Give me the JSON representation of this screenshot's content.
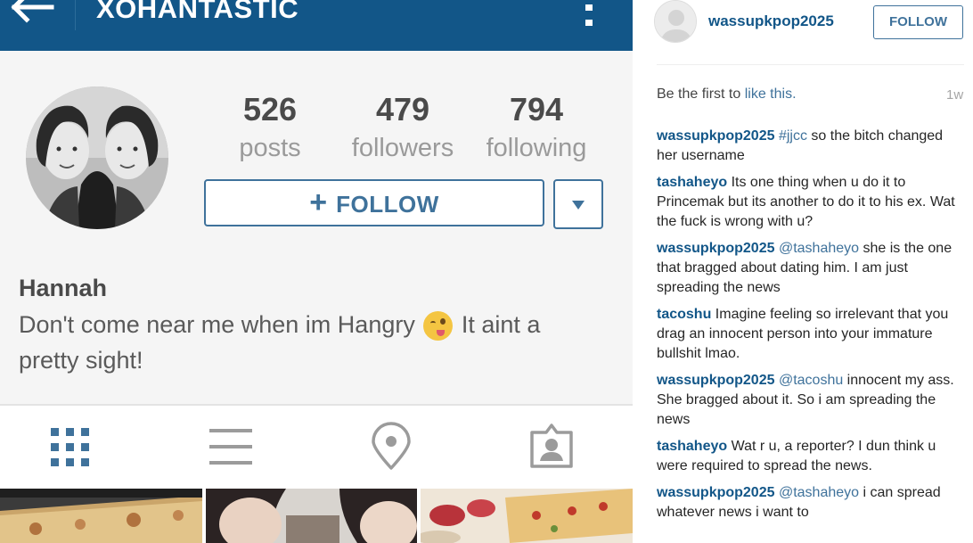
{
  "app_header": {
    "title": "XOHANTASTIC",
    "back_icon": "arrow-left-icon",
    "more_icon": "more-vertical-icon"
  },
  "profile": {
    "avatar": "avatar",
    "stats": [
      {
        "value": "526",
        "label": "posts"
      },
      {
        "value": "479",
        "label": "followers"
      },
      {
        "value": "794",
        "label": "following"
      }
    ],
    "follow_label": "FOLLOW",
    "follow_icon": "plus-icon",
    "dropdown_icon": "caret-down-icon",
    "name": "Hannah",
    "bio_before_emoji": "Don't come near me when im Hangry ",
    "bio_after_emoji": " It aint a pretty sight!",
    "emoji": "winking-face-with-tongue-emoji"
  },
  "tabs": [
    {
      "icon": "grid-icon",
      "active": true
    },
    {
      "icon": "list-icon",
      "active": false
    },
    {
      "icon": "location-pin-icon",
      "active": false
    },
    {
      "icon": "tagged-person-icon",
      "active": false
    }
  ],
  "colors": {
    "header": "#125688",
    "accent": "#3f729b",
    "active_tab": "#3f729b",
    "inactive_tab": "#9b9b9b"
  },
  "post_panel": {
    "username": "wassupkpop2025",
    "follow_label": "FOLLOW",
    "likes_prefix": "Be the first to ",
    "likes_link": "like this.",
    "time": "1w",
    "comments": [
      {
        "user": "wassupkpop2025",
        "mention": "#jjcc",
        "text": " so the bitch changed her username"
      },
      {
        "user": "tashaheyo",
        "mention": "",
        "text": " Its one thing when u do it to Princemak but its another to do it to his ex. Wat the fuck is wrong with u?"
      },
      {
        "user": "wassupkpop2025",
        "mention": "@tashaheyo",
        "text": " she is the one that bragged about dating him. I am just spreading the news"
      },
      {
        "user": "tacoshu",
        "mention": "",
        "text": " Imagine feeling so irrelevant that you drag an innocent person into your immature bullshit lmao."
      },
      {
        "user": "wassupkpop2025",
        "mention": "@tacoshu",
        "text": " innocent my ass. She bragged about it. So i am spreading the news"
      },
      {
        "user": "tashaheyo",
        "mention": "",
        "text": " Wat r u, a reporter? I dun think u were required to spread the news."
      },
      {
        "user": "wassupkpop2025",
        "mention": "@tashaheyo",
        "text": " i can spread whatever news i want to"
      }
    ]
  }
}
